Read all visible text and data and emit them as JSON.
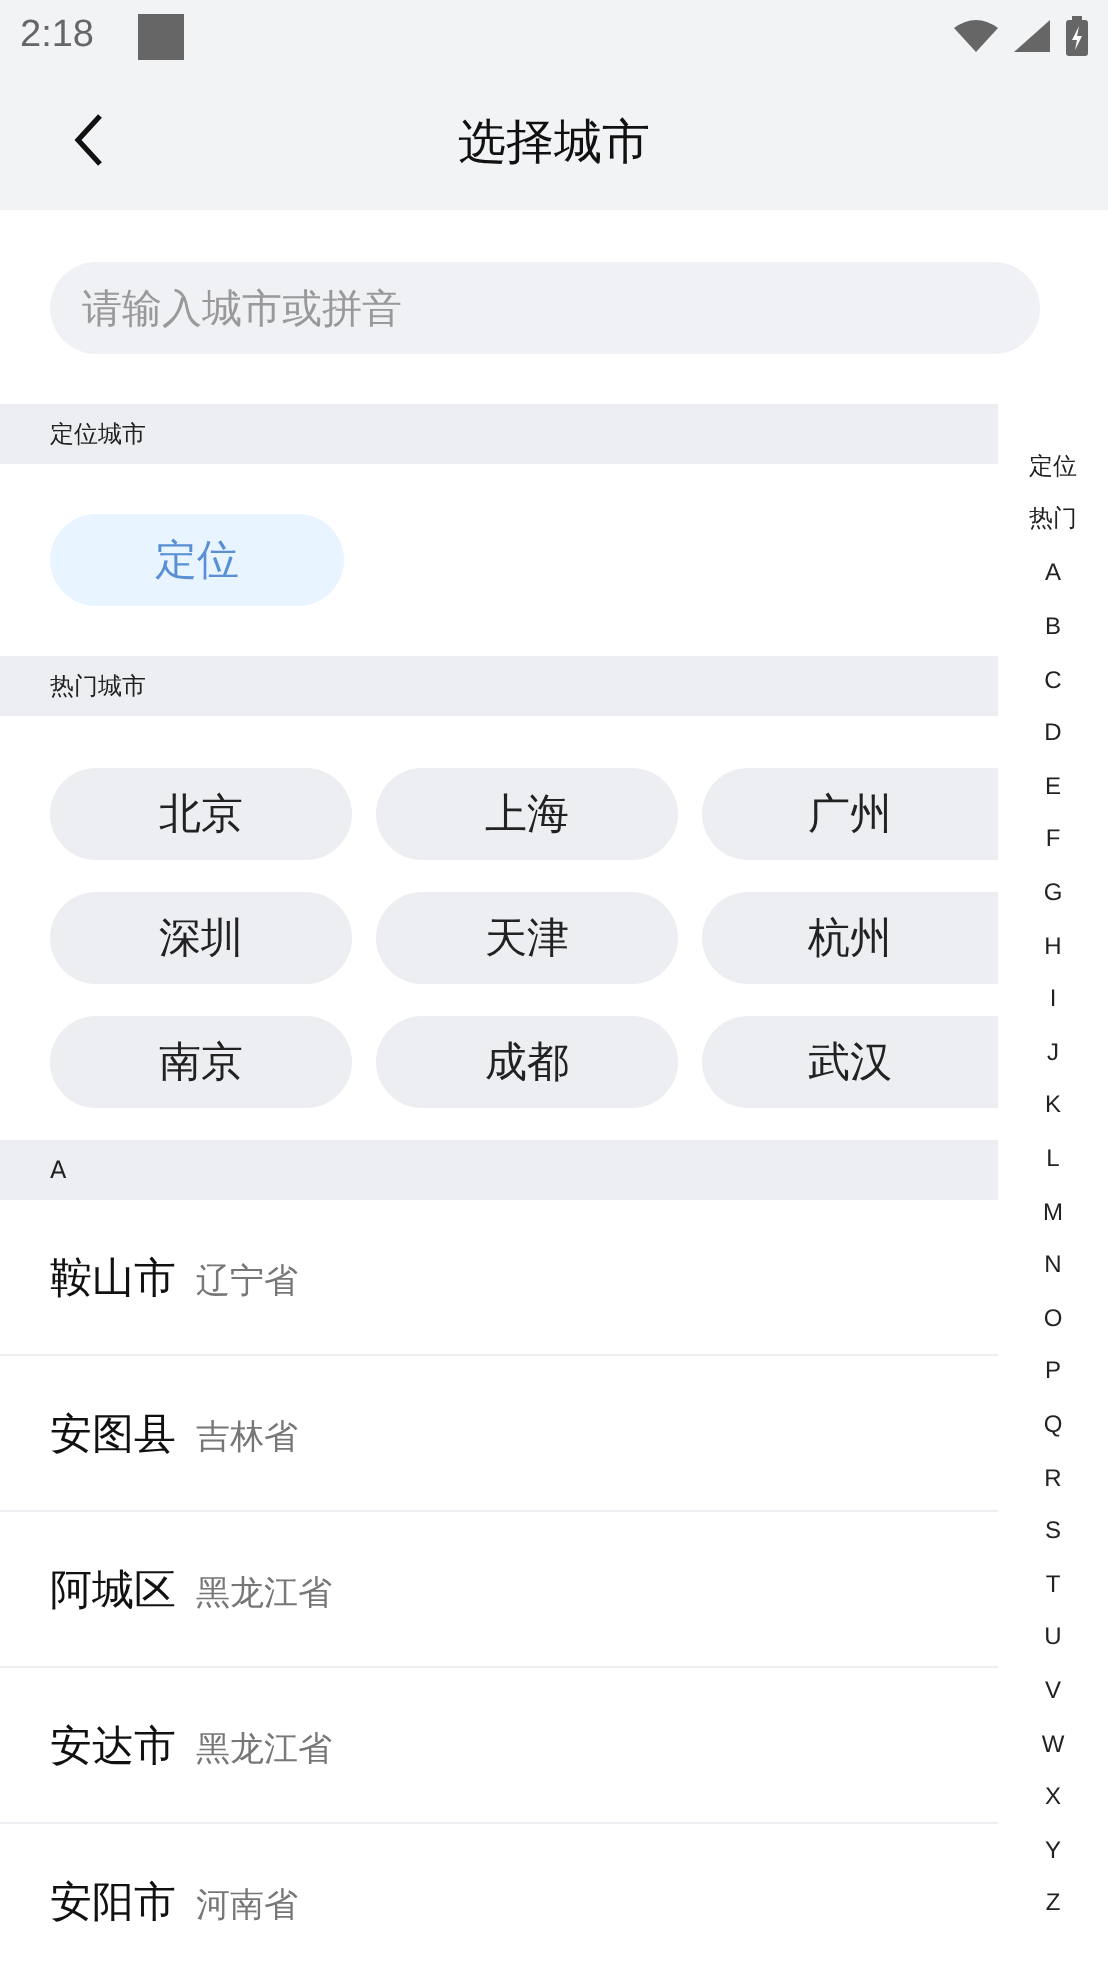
{
  "status_bar": {
    "time": "2:18"
  },
  "header": {
    "title": "选择城市"
  },
  "search": {
    "placeholder": "请输入城市或拼音"
  },
  "location": {
    "heading": "定位城市",
    "button": "定位"
  },
  "hot": {
    "heading": "热门城市",
    "cities": [
      "北京",
      "上海",
      "广州",
      "深圳",
      "天津",
      "杭州",
      "南京",
      "成都",
      "武汉"
    ]
  },
  "list": {
    "heading": "A",
    "rows": [
      {
        "city": "鞍山市",
        "province": "辽宁省"
      },
      {
        "city": "安图县",
        "province": "吉林省"
      },
      {
        "city": "阿城区",
        "province": "黑龙江省"
      },
      {
        "city": "安达市",
        "province": "黑龙江省"
      },
      {
        "city": "安阳市",
        "province": "河南省"
      }
    ]
  },
  "index_bar": [
    "定位",
    "热门",
    "A",
    "B",
    "C",
    "D",
    "E",
    "F",
    "G",
    "H",
    "I",
    "J",
    "K",
    "L",
    "M",
    "N",
    "O",
    "P",
    "Q",
    "R",
    "S",
    "T",
    "U",
    "V",
    "W",
    "X",
    "Y",
    "Z"
  ]
}
